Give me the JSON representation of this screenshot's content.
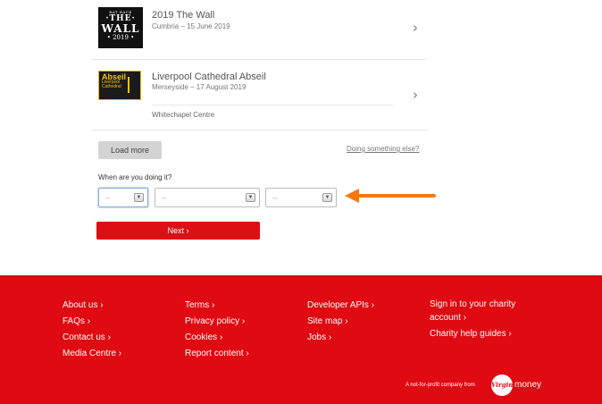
{
  "events": [
    {
      "title": "2019 The Wall",
      "subtitle": "Cumbria – 15 June 2019",
      "thumb": {
        "top": "RAT RACE",
        "the": "·THE·",
        "main": "WALL",
        "year": "• 2019 •"
      }
    },
    {
      "title": "Liverpool Cathedral Abseil",
      "subtitle": "Merseyside – 17 August 2019",
      "charity": "Whitechapel Centre",
      "thumb": {
        "big": "Abseil",
        "small1": "Liverpool",
        "small2": "Cathedral"
      }
    }
  ],
  "controls": {
    "load_more": "Load more",
    "doing_something_else": "Doing something else?",
    "when_label": "When are you doing it?",
    "day_value": "--",
    "month_value": "--",
    "year_value": "--",
    "next": "Next ›"
  },
  "footer": {
    "col1": [
      "About us ›",
      "FAQs ›",
      "Contact us ›",
      "Media Centre ›"
    ],
    "col2": [
      "Terms ›",
      "Privacy policy ›",
      "Cookies ›",
      "Report content ›"
    ],
    "col3": [
      "Developer APIs ›",
      "Site map ›",
      "Jobs ›"
    ],
    "col4": [
      "Sign in to your charity account ›",
      "Charity help guides ›"
    ],
    "tagline": "A not-for-profit company from",
    "logo_word": "Virgin",
    "money": "money"
  },
  "colors": {
    "brand_red": "#e00a12",
    "arrow": "#f07a1a"
  },
  "icons": [
    "chevron-right-icon",
    "dropdown-arrow-icon",
    "orange-arrow-icon",
    "virgin-logo-icon"
  ]
}
